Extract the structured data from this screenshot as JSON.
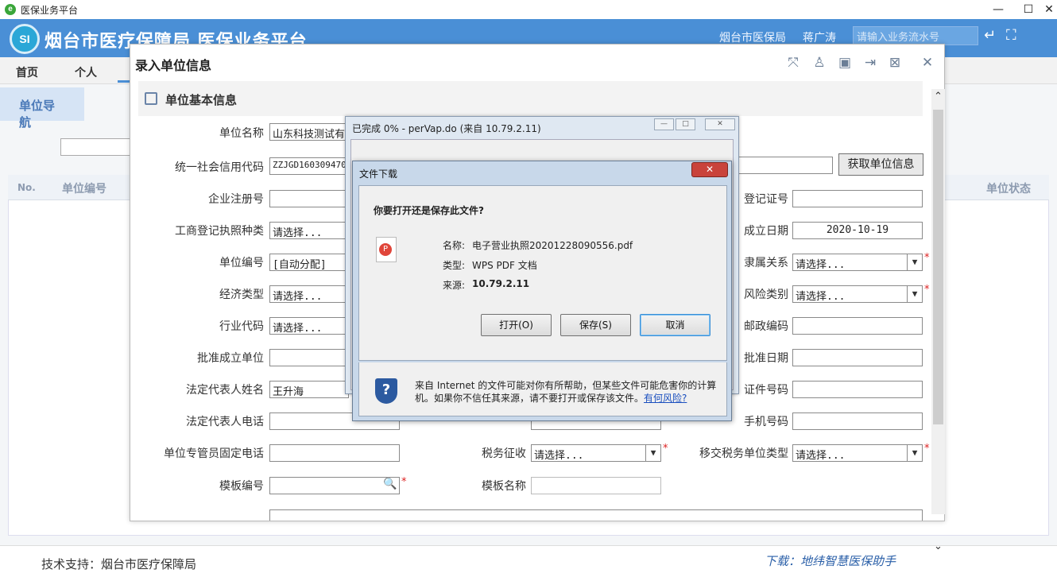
{
  "os_window": {
    "title": "医保业务平台",
    "minimize": "—",
    "maximize": "☐",
    "close": "✕"
  },
  "header": {
    "logo_text": "SI",
    "title": "烟台市医疗保障局  医保业务平台",
    "org": "烟台市医保局",
    "user": "蒋广涛",
    "search_placeholder": "请输入业务流水号"
  },
  "nav": {
    "items": [
      "首页",
      "个人"
    ]
  },
  "sidebar": {
    "button": "单位导航"
  },
  "table": {
    "headers": [
      "No.",
      "单位编号",
      "单位状态"
    ]
  },
  "footer": {
    "support": "技术支持：烟台市医疗保障局",
    "download": "下载：地纬智慧医保助手"
  },
  "dialog": {
    "title": "录入单位信息",
    "section": "单位基本信息",
    "fetch_button": "获取单位信息",
    "fields": {
      "unit_name": {
        "label": "单位名称",
        "value": "山东科技测试有"
      },
      "credit_code": {
        "label": "统一社会信用代码",
        "value": "ZZJGD160309470"
      },
      "enterprise_reg": {
        "label": "企业注册号",
        "value": ""
      },
      "license_type": {
        "label": "工商登记执照种类",
        "value": "请选择..."
      },
      "unit_no": {
        "label": "单位编号",
        "value": "[自动分配]"
      },
      "econ_type": {
        "label": "经济类型",
        "value": "请选择..."
      },
      "industry_code": {
        "label": "行业代码",
        "value": "请选择..."
      },
      "approve_unit": {
        "label": "批准成立单位",
        "value": ""
      },
      "legal_name": {
        "label": "法定代表人姓名",
        "value": "王升海"
      },
      "legal_phone": {
        "label": "法定代表人电话",
        "value": ""
      },
      "mgr_phone": {
        "label": "单位专管员固定电话",
        "value": ""
      },
      "template_no": {
        "label": "模板编号",
        "value": ""
      },
      "tax_collect": {
        "label": "税务征收",
        "value": "请选择..."
      },
      "template_name": {
        "label": "模板名称",
        "value": ""
      },
      "tax_unit_type": {
        "label": "移交税务单位类型",
        "value": "请选择..."
      },
      "reg_no_right": {
        "label": "登记证号",
        "value": ""
      },
      "found_date": {
        "label": "成立日期",
        "value": "2020-10-19"
      },
      "affiliation": {
        "label": "隶属关系",
        "value": "请选择..."
      },
      "risk_type": {
        "label": "风险类别",
        "value": "请选择..."
      },
      "postal_code": {
        "label": "邮政编码",
        "value": ""
      },
      "approve_date": {
        "label": "批准日期",
        "value": ""
      },
      "cert_no": {
        "label": "证件号码",
        "value": ""
      },
      "mobile": {
        "label": "手机号码",
        "value": ""
      }
    }
  },
  "progress": {
    "title": "已完成 0% - perVap.do (来自 10.79.2.11)"
  },
  "file_download": {
    "title": "文件下载",
    "question": "你要打开还是保存此文件?",
    "name_label": "名称:",
    "name": "电子营业执照20201228090556.pdf",
    "type_label": "类型:",
    "type": "WPS PDF 文档",
    "source_label": "来源:",
    "source": "10.79.2.11",
    "open": "打开(O)",
    "save": "保存(S)",
    "cancel": "取消",
    "warning": "来自 Internet 的文件可能对你有所帮助，但某些文件可能危害你的计算机。如果你不信任其来源，请不要打开或保存该文件。",
    "risk_link": "有何风险?"
  }
}
